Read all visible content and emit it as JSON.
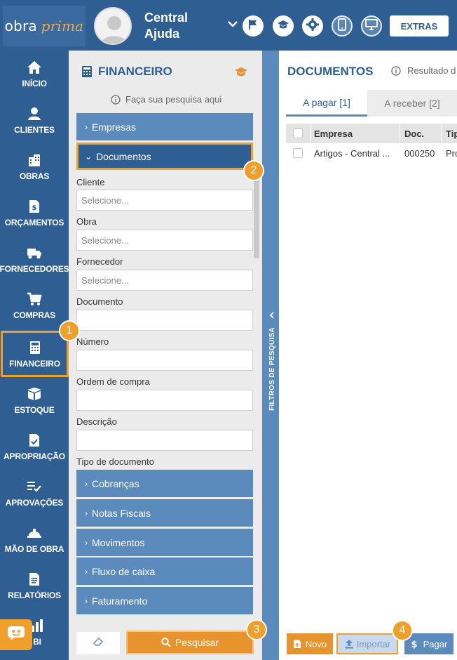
{
  "header": {
    "logo_part1": "obra",
    "logo_part2": "prima",
    "user_name_line1": "Central",
    "user_name_line2": "Ajuda",
    "extras_label": "EXTRAS"
  },
  "nav": {
    "items": [
      {
        "label": "INÍCIO",
        "icon": "home-icon"
      },
      {
        "label": "CLIENTES",
        "icon": "user-icon"
      },
      {
        "label": "OBRAS",
        "icon": "building-icon"
      },
      {
        "label": "ORÇAMENTOS",
        "icon": "dollar-doc-icon"
      },
      {
        "label": "FORNECEDORES",
        "icon": "truck-icon"
      },
      {
        "label": "COMPRAS",
        "icon": "cart-icon"
      },
      {
        "label": "FINANCEIRO",
        "icon": "calculator-icon"
      },
      {
        "label": "ESTOQUE",
        "icon": "box-icon"
      },
      {
        "label": "APROPRIAÇÃO",
        "icon": "doc-check-icon"
      },
      {
        "label": "APROVAÇÕES",
        "icon": "list-check-icon"
      },
      {
        "label": "MÃO DE OBRA",
        "icon": "helmet-icon"
      },
      {
        "label": "RELATÓRIOS",
        "icon": "report-icon"
      },
      {
        "label": "BI",
        "icon": "bar-chart-icon"
      }
    ],
    "active_index": 6
  },
  "badges": {
    "b1": "1",
    "b2": "2",
    "b3": "3",
    "b4": "4"
  },
  "filter": {
    "title": "FINANCEIRO",
    "hint": "Faça sua pesquisa aqui",
    "sections": {
      "empresas": "Empresas",
      "documentos": "Documentos",
      "cobrancas": "Cobranças",
      "notas_fiscais": "Notas Fiscais",
      "movimentos": "Movimentos",
      "fluxo_caixa": "Fluxo de caixa",
      "faturamento": "Faturamento"
    },
    "fields": {
      "cliente_label": "Cliente",
      "cliente_placeholder": "Selecione...",
      "obra_label": "Obra",
      "obra_placeholder": "Selecione...",
      "fornecedor_label": "Fornecedor",
      "fornecedor_placeholder": "Selecione...",
      "documento_label": "Documento",
      "numero_label": "Número",
      "ordem_compra_label": "Ordem de compra",
      "descricao_label": "Descrição",
      "tipo_documento_label": "Tipo de documento"
    },
    "search_label": "Pesquisar",
    "vertical_tab_label": "FILTROS DE PESQUISA"
  },
  "main": {
    "title": "DOCUMENTOS",
    "result_hint": "Resultado d",
    "tabs": [
      {
        "label": "A pagar [1]",
        "active": true
      },
      {
        "label": "A receber [2]",
        "active": false
      }
    ],
    "table": {
      "columns": [
        "Empresa",
        "Doc.",
        "Tip"
      ],
      "rows": [
        {
          "empresa": "Artigos - Central ...",
          "doc": "000250",
          "tipo": "Pro"
        }
      ]
    },
    "buttons": {
      "novo": "Novo",
      "importar": "Importar",
      "pagar": "Pagar"
    }
  },
  "colors": {
    "primary": "#2f5f92",
    "accent": "#f0a02a",
    "section": "#5b8abd"
  }
}
